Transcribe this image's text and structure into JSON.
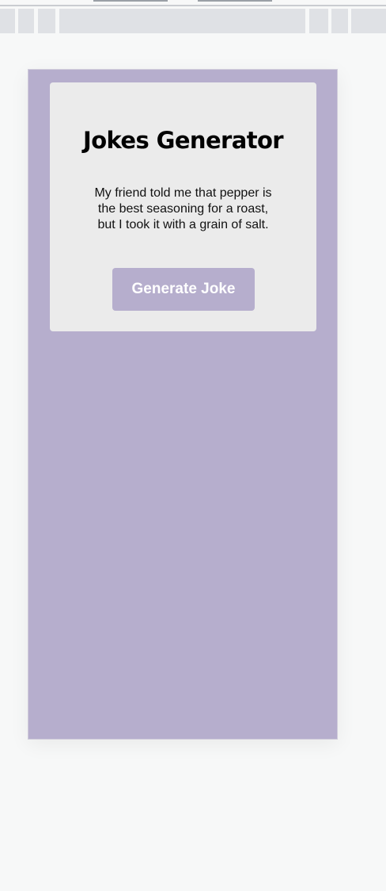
{
  "colors": {
    "page_background": "#f7f8f8",
    "device_background": "#b6aecd",
    "card_background": "#ebebeb",
    "button_background": "#b6aecd",
    "button_text": "#ffffff",
    "chrome_bar": "#dfe1e5"
  },
  "card": {
    "title": "Jokes Generator",
    "joke": "My friend told me that pepper is the best seasoning for a roast, but I took it with a grain of salt.",
    "button_label": "Generate Joke"
  }
}
